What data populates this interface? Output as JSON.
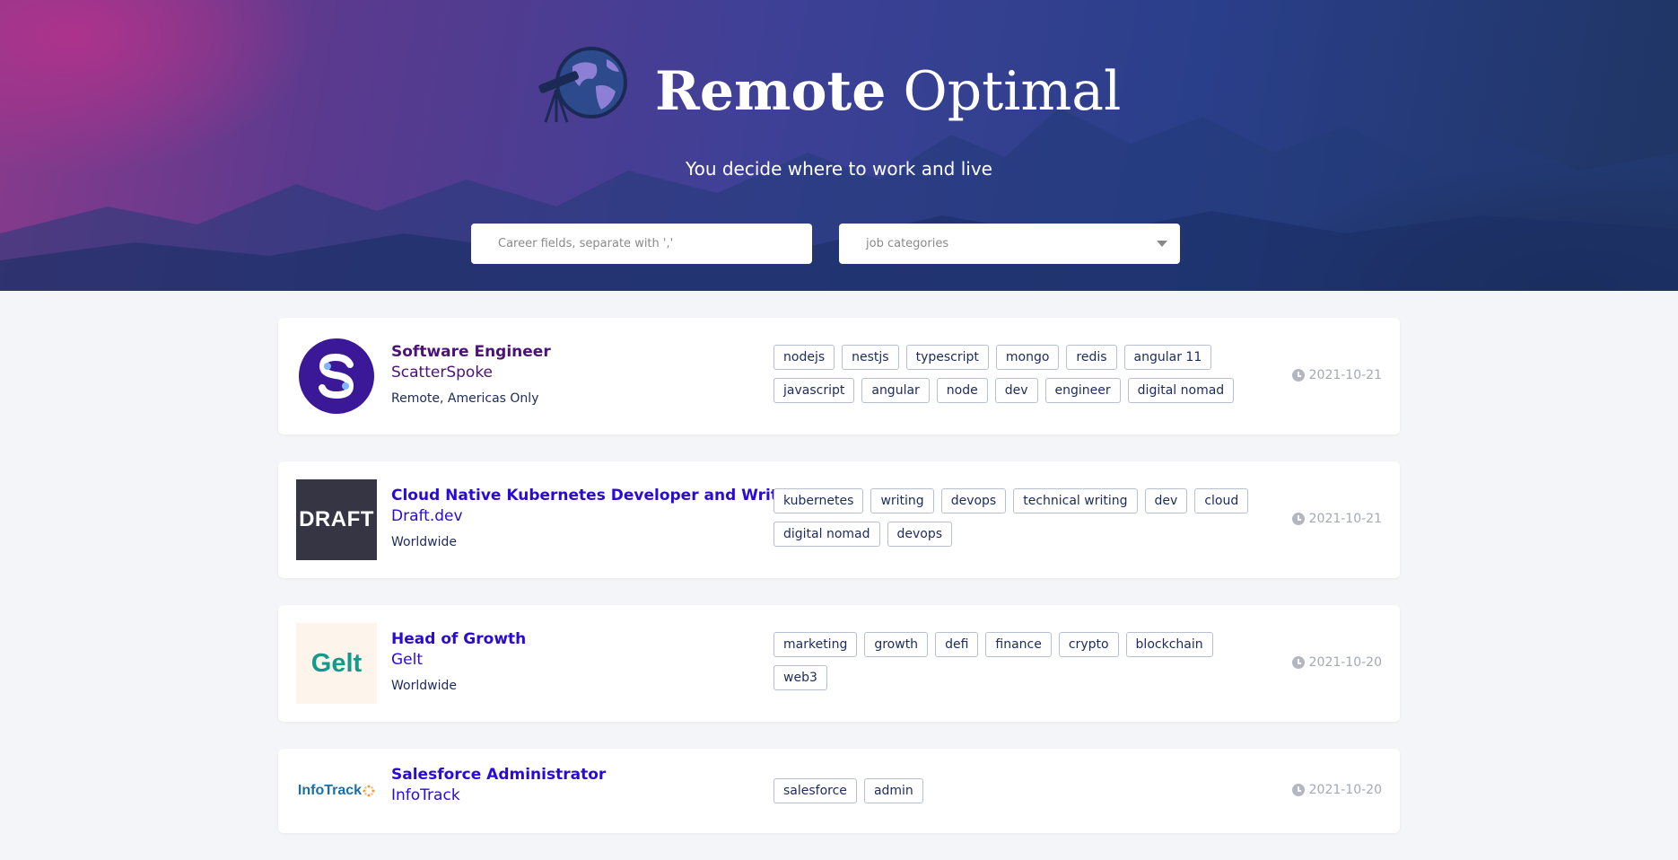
{
  "brand": {
    "title_bold": "Remote",
    "title_light": "Optimal",
    "tagline": "You decide where to work and live",
    "logo_icon": "telescope-globe-icon"
  },
  "search": {
    "placeholder": "Career fields, separate with ','",
    "category_placeholder": "job categories"
  },
  "colors": {
    "link": "#2a0bd6",
    "visited_link": "#4b1278",
    "tag_border": "#b8bfcf",
    "date": "#a4a9b6"
  },
  "jobs": [
    {
      "title": "Software Engineer",
      "company": "ScatterSpoke",
      "location": "Remote, Americas Only",
      "tags": [
        "nodejs",
        "nestjs",
        "typescript",
        "mongo",
        "redis",
        "angular 11",
        "javascript",
        "angular",
        "node",
        "dev",
        "engineer",
        "digital nomad"
      ],
      "date": "2021-10-21",
      "logo": "scatterspoke-logo"
    },
    {
      "title": "Cloud Native Kubernetes Developer and Writer",
      "company": "Draft.dev",
      "location": "Worldwide",
      "tags": [
        "kubernetes",
        "writing",
        "devops",
        "technical writing",
        "dev",
        "cloud",
        "digital nomad",
        "devops"
      ],
      "date": "2021-10-21",
      "logo_text": "DRAFT"
    },
    {
      "title": "Head of Growth",
      "company": "Gelt",
      "location": "Worldwide",
      "tags": [
        "marketing",
        "growth",
        "defi",
        "finance",
        "crypto",
        "blockchain",
        "web3"
      ],
      "date": "2021-10-20",
      "logo_text": "Gelt"
    },
    {
      "title": "Salesforce Administrator",
      "company": "InfoTrack",
      "location": "",
      "tags": [
        "salesforce",
        "admin"
      ],
      "date": "2021-10-20",
      "logo_text": "InfoTrack"
    }
  ]
}
